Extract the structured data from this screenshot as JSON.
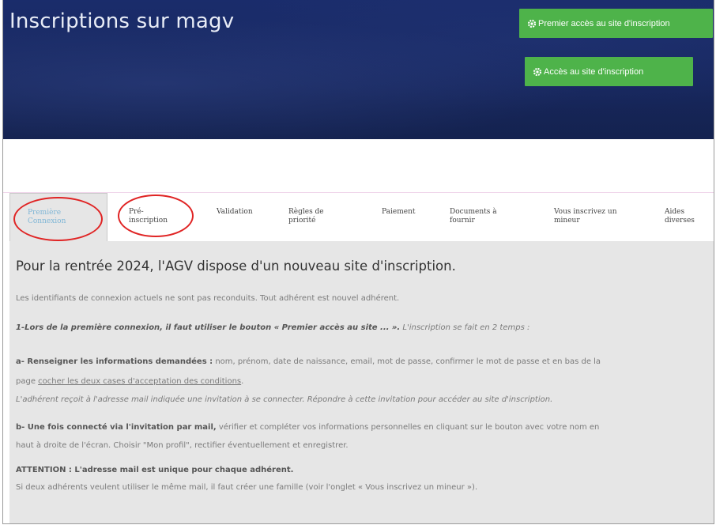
{
  "header": {
    "title": "Inscriptions sur magv",
    "button_first_access": "Premier accès au site d'inscription",
    "button_access": "Accès au site d'inscription",
    "button_icon": "gear-icon",
    "colors": {
      "banner": "#17275d",
      "button": "#4eb34a",
      "annotation_circle": "#e02424"
    }
  },
  "tabs": [
    {
      "label_line1": "Première",
      "label_line2": "Connexion",
      "active": true
    },
    {
      "label_line1": "Pré-",
      "label_line2": "inscription",
      "active": false
    },
    {
      "label_line1": "Validation",
      "label_line2": "",
      "active": false
    },
    {
      "label_line1": "Règles de",
      "label_line2": "priorité",
      "active": false
    },
    {
      "label_line1": "Paiement",
      "label_line2": "",
      "active": false
    },
    {
      "label_line1": "Documents à",
      "label_line2": "fournir",
      "active": false
    },
    {
      "label_line1": "Vous inscrivez un",
      "label_line2": "mineur",
      "active": false
    },
    {
      "label_line1": "Aides",
      "label_line2": "diverses",
      "active": false
    }
  ],
  "content": {
    "heading": "Pour la rentrée 2024, l'AGV dispose d'un nouveau site d'inscription.",
    "p1": "Les identifiants de connexion actuels ne sont pas reconduits. Tout adhérent est nouvel adhérent.",
    "p2_bold": "1-Lors de la première connexion, il faut utiliser le bouton « Premier accès au site ... ».",
    "p2_rest": " L'inscription se fait en 2 temps :",
    "p3_bold": "a- Renseigner les informations demandées :",
    "p3_rest": " nom, prénom, date de naissance, email, mot de passe, confirmer le mot de passe et en bas de la",
    "p3_line2_pre": "page ",
    "p3_line2_link": "cocher les deux cases d'acceptation des conditions",
    "p3_line2_post": ".",
    "p4": "L'adhérent reçoit à l'adresse mail indiquée une invitation à se connecter.  Répondre à cette invitation pour accéder au site d'inscription.",
    "p5_bold": "b- Une fois connecté via l'invitation par mail,",
    "p5_rest": " vérifier et compléter vos informations personnelles en cliquant sur le bouton avec votre nom en",
    "p5_line2": "haut à droite de l'écran. Choisir \"Mon profil\", rectifier éventuellement et enregistrer.",
    "p6_bold": "ATTENTION : L'adresse mail est unique pour chaque adhérent.",
    "p7": "Si deux adhérents veulent utiliser le même mail, il faut créer une famille (voir l'onglet « Vous inscrivez un mineur »)."
  }
}
